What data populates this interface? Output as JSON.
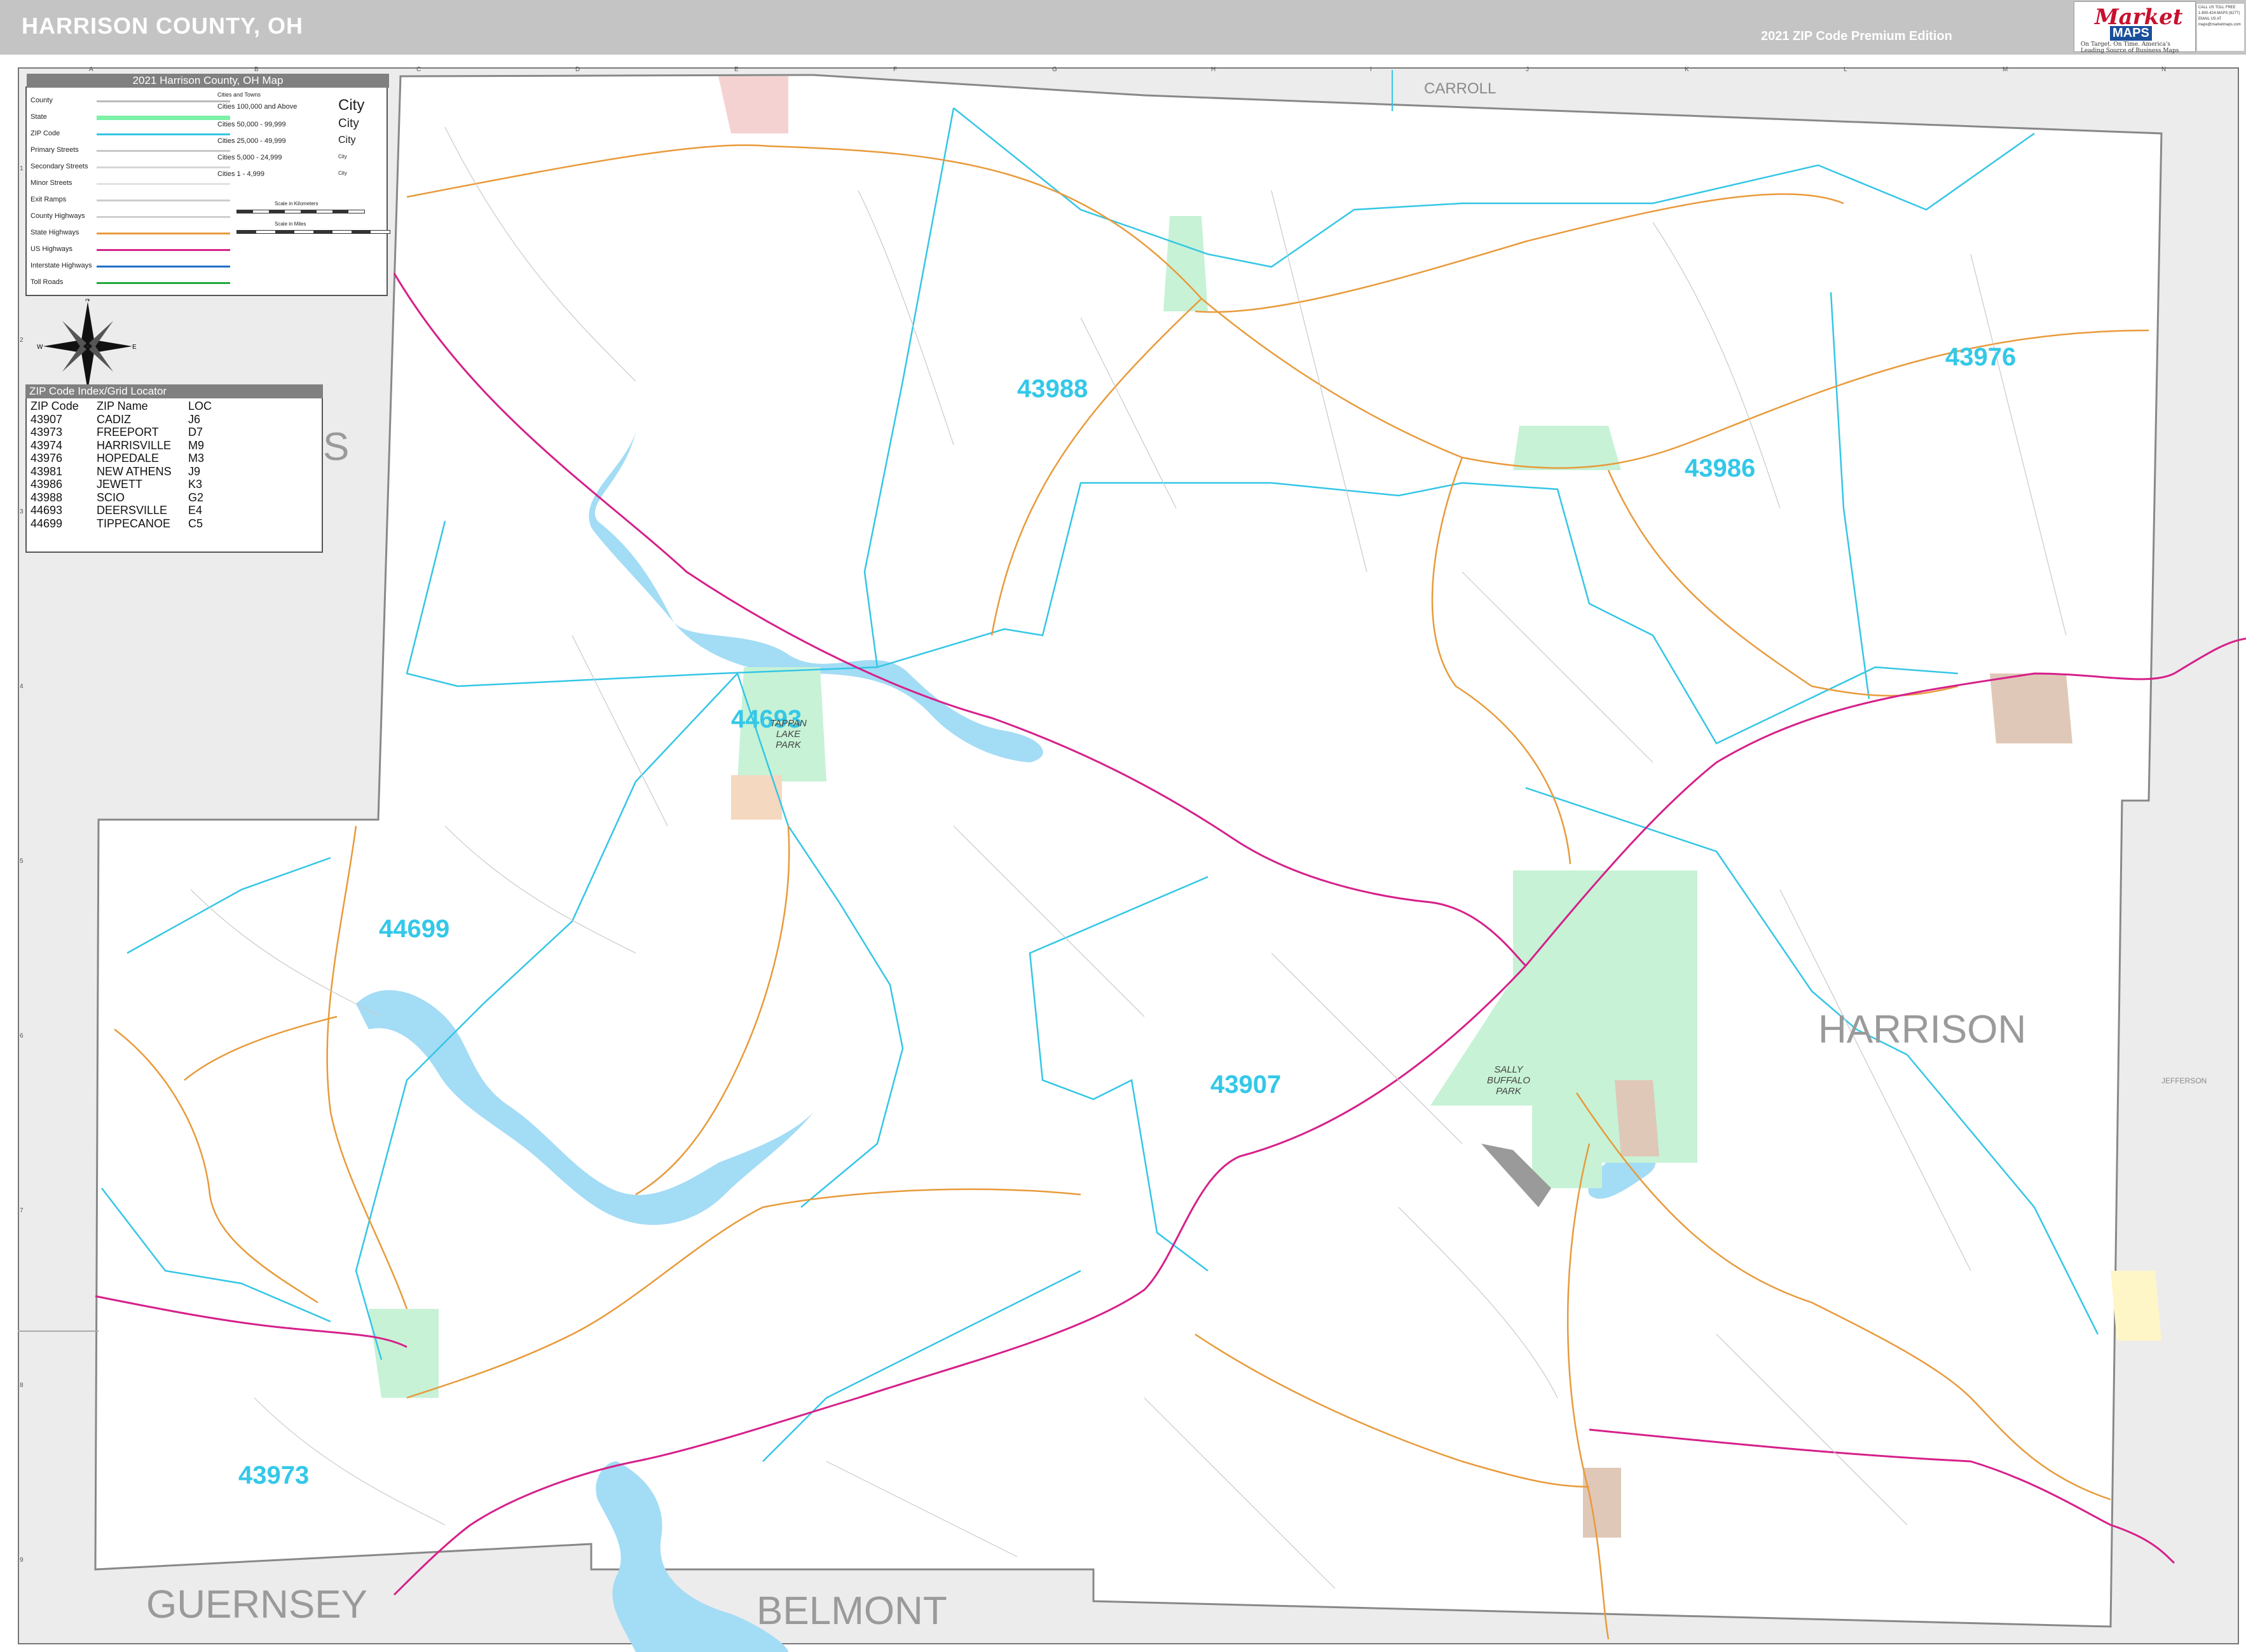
{
  "header": {
    "title": "HARRISON COUNTY, OH",
    "edition": "2021 ZIP Code Premium Edition",
    "logo_brand": "Market",
    "logo_sub": "MAPS",
    "logo_tagline": "On Target. On Time. America's Leading Source of Business Maps",
    "contact_lines": [
      "CALL US TOLL FREE",
      "1-800-424-MAPS (6277)",
      "EMAIL US AT",
      "maps@marketmaps.com"
    ]
  },
  "map_title": "2021 Harrison County, OH Map",
  "legend": {
    "line_items": [
      {
        "label": "County",
        "color": "#bbbbbb"
      },
      {
        "label": "State",
        "color": "#7cf2a8"
      },
      {
        "label": "ZIP Code",
        "color": "#34c6e6"
      },
      {
        "label": "Primary Streets",
        "color": "#c8c8c8"
      },
      {
        "label": "Secondary Streets",
        "color": "#d6d6d6"
      },
      {
        "label": "Minor Streets",
        "color": "#e2e2e2"
      },
      {
        "label": "Exit Ramps",
        "color": "#cccccc"
      },
      {
        "label": "County Highways",
        "color": "#cfcfcf"
      },
      {
        "label": "State Highways",
        "color": "#e89a3a"
      },
      {
        "label": "US Highways",
        "color": "#d6208a"
      },
      {
        "label": "Interstate Highways",
        "color": "#1e6fc8"
      },
      {
        "label": "Toll Roads",
        "color": "#22a83a"
      }
    ],
    "city_header": "Cities and Towns",
    "city_items": [
      {
        "label": "Cities 100,000 and Above",
        "sample": "City"
      },
      {
        "label": "Cities 50,000 - 99,999",
        "sample": "City"
      },
      {
        "label": "Cities 25,000 - 49,999",
        "sample": "City"
      },
      {
        "label": "Cities 5,000 - 24,999",
        "sample": "City"
      },
      {
        "label": "Cities 1 - 4,999",
        "sample": "City"
      }
    ],
    "scale_km": "Scale in Kilometers",
    "scale_mi": "Scale in Miles"
  },
  "compass": {
    "n": "N",
    "s": "S",
    "e": "E",
    "w": "W"
  },
  "zip_index": {
    "header": "ZIP Code Index/Grid Locator",
    "columns": [
      "ZIP Code",
      "ZIP Name",
      "LOC"
    ],
    "rows": [
      [
        "43907",
        "CADIZ",
        "J6"
      ],
      [
        "43973",
        "FREEPORT",
        "D7"
      ],
      [
        "43974",
        "HARRISVILLE",
        "M9"
      ],
      [
        "43976",
        "HOPEDALE",
        "M3"
      ],
      [
        "43981",
        "NEW ATHENS",
        "J9"
      ],
      [
        "43986",
        "JEWETT",
        "K3"
      ],
      [
        "43988",
        "SCIO",
        "G2"
      ],
      [
        "44693",
        "DEERSVILLE",
        "E4"
      ],
      [
        "44699",
        "TIPPECANOE",
        "C5"
      ]
    ]
  },
  "grid": {
    "columns": [
      "A",
      "B",
      "C",
      "D",
      "E",
      "F",
      "G",
      "H",
      "I",
      "J",
      "K",
      "L",
      "M",
      "N"
    ],
    "rows": [
      "1",
      "2",
      "3",
      "4",
      "5",
      "6",
      "7",
      "8",
      "9"
    ]
  },
  "counties": {
    "harrison": "HARRISON",
    "guernsey": "GUERNSEY",
    "belmont": "BELMONT",
    "carroll": "CARROLL",
    "jefferson": "JEFFERSON",
    "tuscarawas_fragment": "S"
  },
  "zip_labels": [
    "43988",
    "43976",
    "43986",
    "44693",
    "44699",
    "43907",
    "43973"
  ],
  "parks": {
    "tappan": "TAPPAN LAKE PARK",
    "sally": "SALLY BUFFALO PARK"
  },
  "colors": {
    "water": "#a3dcf5",
    "park": "#c7f2d6",
    "zip_line": "#34c6e6",
    "us_highway": "#d6208a",
    "state_highway": "#e89a3a",
    "town": "#e0c8b8",
    "outside": "#ececec"
  }
}
